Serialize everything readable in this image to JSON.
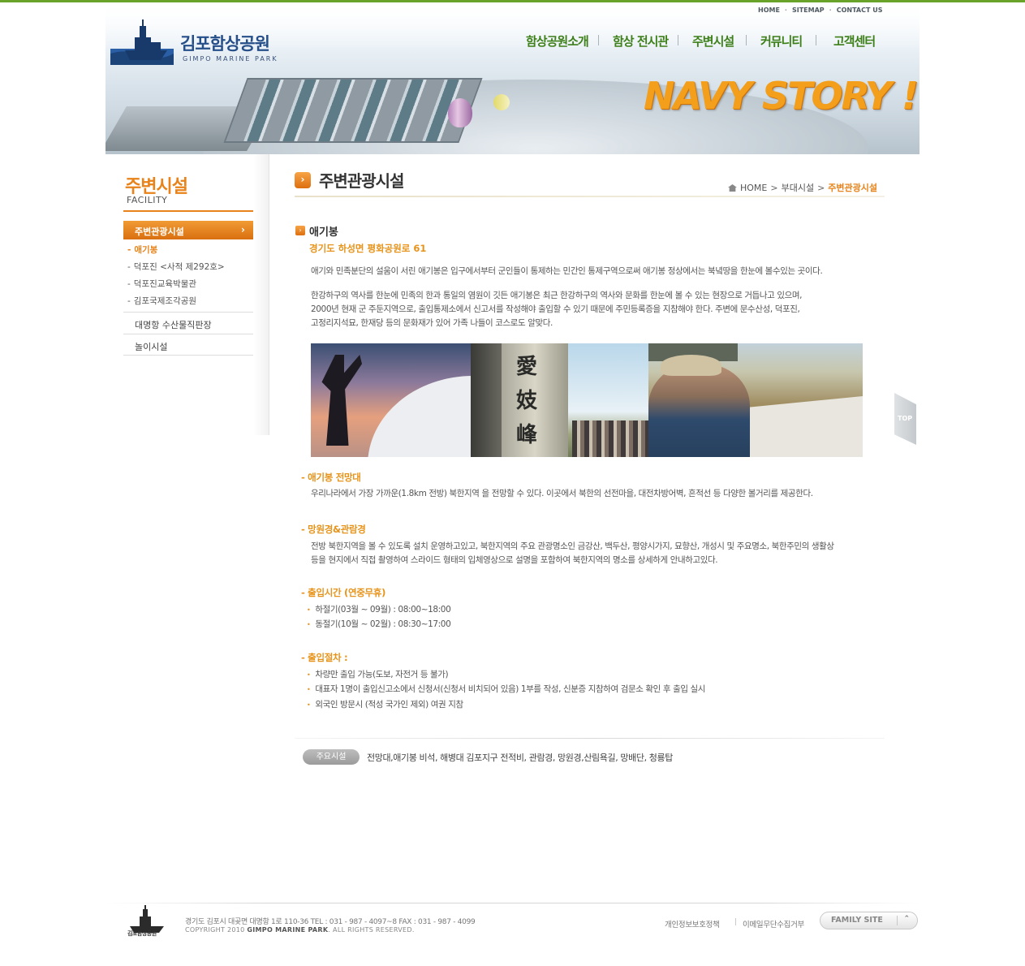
{
  "header": {
    "logo_title": "김포함상공원",
    "logo_subtitle": "GIMPO MARINE PARK",
    "util_links": [
      "HOME",
      "SITEMAP",
      "CONTACT US"
    ],
    "gnb": [
      "함상공원소개",
      "함상 전시관",
      "주변시설",
      "커뮤니티",
      "고객센터"
    ],
    "visual_text": "NAVY STORY !"
  },
  "sidebar": {
    "title": "주변시설",
    "subtitle": "FACILITY",
    "active": "주변관광시설",
    "sub_items": [
      "애기봉",
      "덕포진 <사적 제292호>",
      "덕포진교육박물관",
      "김포국제조각공원"
    ],
    "menu": [
      "대명항 수산물직판장",
      "놀이시설"
    ]
  },
  "content": {
    "title": "주변관광시설",
    "breadcrumb": [
      "HOME",
      "부대시설",
      "주변관광시설"
    ],
    "section_title": "애기봉",
    "address": "경기도 하성면 평화공원로 61",
    "para1": "애기와 민족분단의 설움이 서린 애기봉은 입구에서부터 군인들이 통제하는 민간인 통제구역으로써  애기봉 정상에서는 북녘땅을 한눈에 볼수있는 곳이다.",
    "para2_lines": [
      "한강하구의 역사를 한눈에 민족의 한과 통일의 염원이 깃든 애기봉은 최근 한강하구의 역사와 문화를 한눈에 볼 수 있는 현장으로 거듭나고 있으며,",
      "2000년 현재 군 주둔지역으로, 출입통제소에서 신고서를 작성해야 출입할 수 있기 때문에 주민등록증을 지참해야 한다. 주변에 문수산성, 덕포진,",
      "고정리지석묘, 한재당 등의 문화재가 있어 가족 나들이 코스로도 알맞다."
    ],
    "stone_chars": [
      "愛",
      "妓",
      "峰"
    ],
    "observatory_title": "- 애기봉 전망대",
    "observatory_text": "우리나라에서 가장 가까운(1.8km 전방) 북한지역 을 전망할 수 있다. 이곳에서 북한의 선전마을, 대전차방어벽, 흔적선 등 다양한 볼거리를 제공한다.",
    "telescope_title": "- 망원경&관람경",
    "telescope_lines": [
      "전방 북한지역을 볼 수 있도록 설치 운영하고있고, 북한지역의 주요 관광명소인 금강산, 백두산, 평양시가지, 묘향산, 개성시 및 주요명소, 북한주민의 생활상",
      "등을 현지에서 직접 촬영하여 스라이드 형태의 입체영상으로 설명을 포함하여 북한지역의 명소를 상세하게 안내하고있다."
    ],
    "hours_title": "- 출입시간 (연중무휴)",
    "hours": [
      "하절기(03월 ~ 09월) : 08:00~18:00",
      "동절기(10월 ~ 02월) : 08:30~17:00"
    ],
    "procedure_title": "- 출입절차 :",
    "procedure": [
      "차량만 출입 가능(도보, 자전거 등 불가)",
      "대표자 1명이 출입신고소에서 신청서(신청서 비치되어 있음) 1부를 작성, 신분증 지참하여 검문소 확인 후 출입 실시",
      "외국인 방문시 (적성 국가인 제외) 여권 지참"
    ],
    "facilities_label": "주요시설",
    "facilities_text": "전망대,애기봉 비석, 해병대 김포지구 전적비, 관람경, 망원경,산림욕길, 망배단, 청룡탑"
  },
  "top_button": "TOP",
  "footer": {
    "logo_text": "김포함상공원",
    "address": "경기도 김포시 대곶면 대명항 1로 110-36  TEL : 031 - 987 - 4097~8     FAX : 031 - 987 - 4099",
    "copyright_prefix": "COPYRIGHT 2010",
    "copyright_brand": "GIMPO MARINE PARK",
    "copyright_suffix": ". ALL RIGHTS RESERVED.",
    "links": [
      "개인정보보호정책",
      "이메일무단수집거부"
    ],
    "family_site": "FAMILY SITE"
  },
  "colors": {
    "accent": "#e7831a",
    "brand_green": "#3d7f19",
    "logo_blue": "#264f8a"
  }
}
